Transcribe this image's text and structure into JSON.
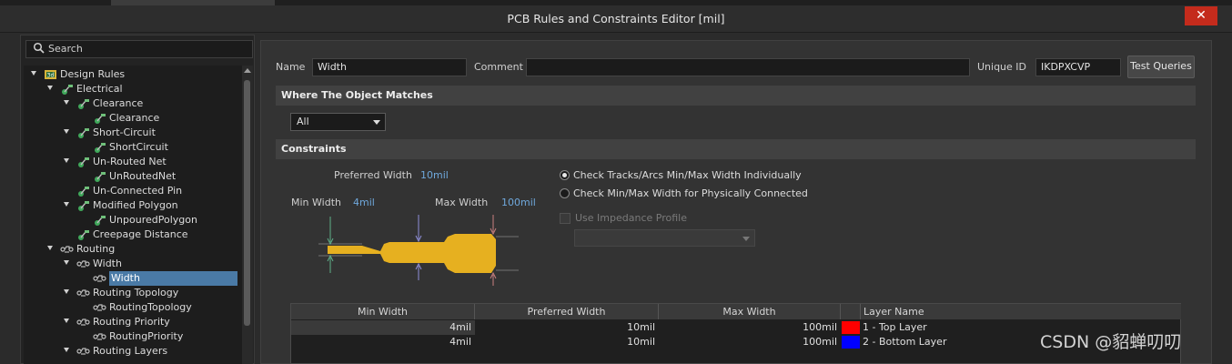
{
  "window": {
    "title": "PCB Rules and Constraints Editor [mil]",
    "close_glyph": "✕"
  },
  "search": {
    "label": "Search",
    "icon": "search-icon"
  },
  "tree": {
    "items": [
      {
        "label": "Design Rules",
        "icon": "design-rules-icon"
      },
      {
        "label": "Electrical",
        "icon": "rule-category-icon"
      },
      {
        "label": "Clearance",
        "icon": "rule-category-icon"
      },
      {
        "label": "Clearance",
        "icon": "rule-icon"
      },
      {
        "label": "Short-Circuit",
        "icon": "rule-category-icon"
      },
      {
        "label": "ShortCircuit",
        "icon": "rule-icon"
      },
      {
        "label": "Un-Routed Net",
        "icon": "rule-category-icon"
      },
      {
        "label": "UnRoutedNet",
        "icon": "rule-icon"
      },
      {
        "label": "Un-Connected Pin",
        "icon": "rule-category-icon"
      },
      {
        "label": "Modified Polygon",
        "icon": "rule-category-icon"
      },
      {
        "label": "UnpouredPolygon",
        "icon": "rule-icon"
      },
      {
        "label": "Creepage Distance",
        "icon": "rule-category-icon"
      },
      {
        "label": "Routing",
        "icon": "routing-icon"
      },
      {
        "label": "Width",
        "icon": "routing-icon"
      },
      {
        "label": "Width",
        "icon": "routing-icon"
      },
      {
        "label": "Routing Topology",
        "icon": "routing-icon"
      },
      {
        "label": "RoutingTopology",
        "icon": "routing-icon"
      },
      {
        "label": "Routing Priority",
        "icon": "routing-icon"
      },
      {
        "label": "RoutingPriority",
        "icon": "routing-icon"
      },
      {
        "label": "Routing Layers",
        "icon": "routing-icon"
      }
    ],
    "selected_label": "Width"
  },
  "rule": {
    "name_label": "Name",
    "name_value": "Width",
    "comment_label": "Comment",
    "comment_value": "",
    "unique_id_label": "Unique ID",
    "unique_id_value": "IKDPXCVP",
    "test_queries_label": "Test Queries"
  },
  "match": {
    "section_title": "Where The Object Matches",
    "selected_option": "All"
  },
  "constraints": {
    "section_title": "Constraints",
    "preferred_width_label": "Preferred Width",
    "preferred_width_value": "10mil",
    "min_width_label": "Min Width",
    "min_width_value": "4mil",
    "max_width_label": "Max Width",
    "max_width_value": "100mil",
    "option_individual": "Check Tracks/Arcs Min/Max Width Individually",
    "option_connected": "Check Min/Max Width for Physically Connected",
    "selected_option": "individual",
    "impedance_label": "Use Impedance Profile",
    "track_color": "#e6b020"
  },
  "layers_table": {
    "headers": [
      "Min Width",
      "Preferred Width",
      "Max Width",
      "Layer Name"
    ],
    "rows": [
      {
        "min": "4mil",
        "preferred": "10mil",
        "max": "100mil",
        "layer": "1 - Top Layer",
        "color": "#ff0000"
      },
      {
        "min": "4mil",
        "preferred": "10mil",
        "max": "100mil",
        "layer": "2 - Bottom Layer",
        "color": "#0000ff"
      }
    ]
  },
  "watermark": {
    "text": "CSDN @貂蝉叨叨"
  }
}
